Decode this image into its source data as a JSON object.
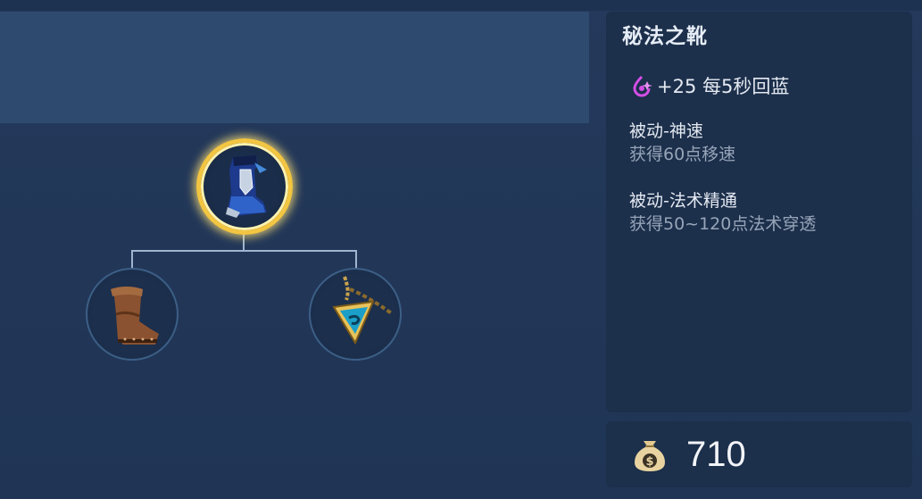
{
  "item": {
    "name": "秘法之靴",
    "stat": "+25 每5秒回蓝",
    "passives": [
      {
        "name": "被动-神速",
        "desc": "获得60点移速"
      },
      {
        "name": "被动-法术精通",
        "desc": "获得50~120点法术穿透"
      }
    ],
    "price": "710"
  },
  "tree": {
    "main": "magic-boots-icon",
    "components": [
      "leather-boots-icon",
      "amulet-icon"
    ]
  },
  "colors": {
    "highlight": "#f2c542",
    "mana_icon": "#d44fe6",
    "panel": "#1c2f4b",
    "background": "#24395b"
  }
}
